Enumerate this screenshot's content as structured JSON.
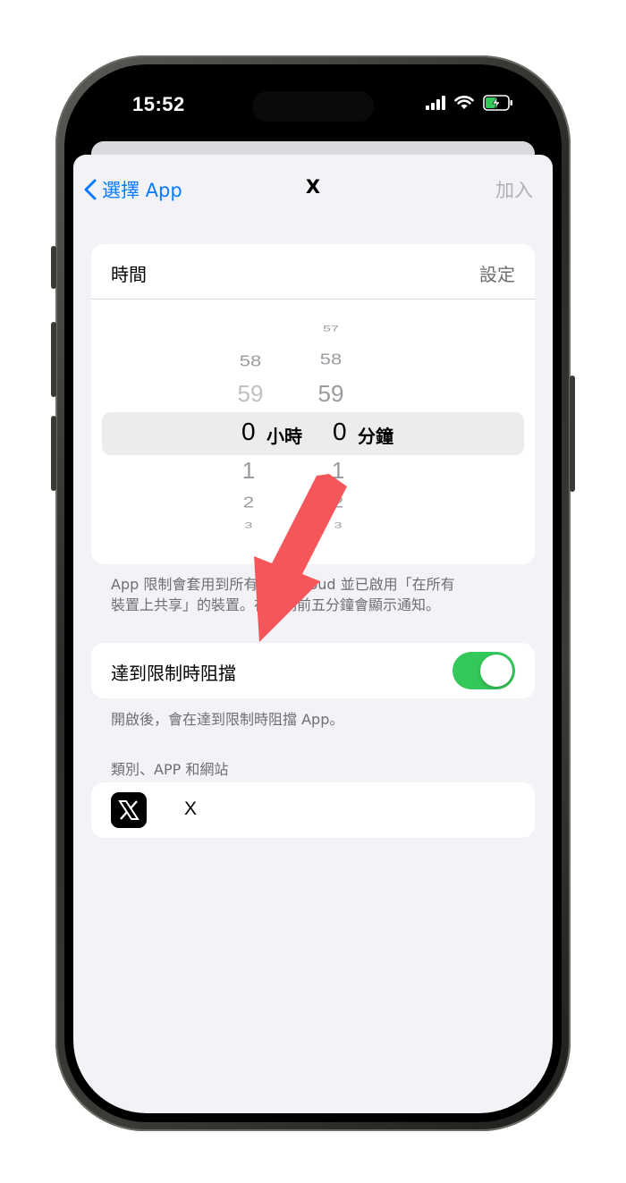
{
  "status_bar": {
    "time": "15:52"
  },
  "nav": {
    "back_label": "選擇 App",
    "title": "X",
    "add_label": "加入"
  },
  "time_section": {
    "label": "時間",
    "value": "設定",
    "picker": {
      "hours_above": [
        "58",
        "59"
      ],
      "hours_selected": "0",
      "hours_unit": "小時",
      "hours_below": [
        "1",
        "2",
        "3"
      ],
      "minutes_above": [
        "57",
        "58",
        "59"
      ],
      "minutes_selected": "0",
      "minutes_unit": "分鐘",
      "minutes_below": [
        "1",
        "2",
        "3"
      ]
    }
  },
  "time_footer_line1": "App 限制會套用到所有使用 iCloud 並已啟用「在所有",
  "time_footer_line2": "裝置上共享」的裝置。在限制前五分鐘會顯示通知。",
  "block": {
    "label": "達到限制時阻擋",
    "enabled": true,
    "footer": "開啟後，會在達到限制時阻擋 App。"
  },
  "apps_section": {
    "header": "類別、APP 和網站",
    "items": [
      {
        "name": "X",
        "icon": "x-logo-icon"
      }
    ]
  },
  "colors": {
    "accent": "#0a7aff",
    "toggle_on": "#34c759",
    "arrow": "#f5565a",
    "background": "#f2f2f7"
  }
}
